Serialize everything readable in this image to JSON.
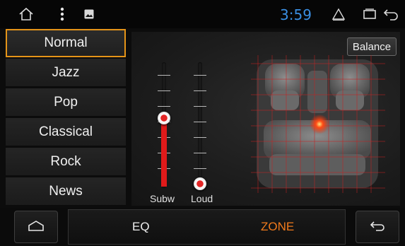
{
  "status_bar": {
    "time": "3:59",
    "icons": [
      "home-outline-icon",
      "more-vert-icon",
      "gallery-icon",
      "alert-triangle-icon",
      "recent-apps-icon",
      "back-arrow-icon"
    ],
    "time_color": "#3a8fe3"
  },
  "presets": [
    {
      "label": "Normal",
      "selected": true
    },
    {
      "label": "Jazz",
      "selected": false
    },
    {
      "label": "Pop",
      "selected": false
    },
    {
      "label": "Classical",
      "selected": false
    },
    {
      "label": "Rock",
      "selected": false
    },
    {
      "label": "News",
      "selected": false
    }
  ],
  "sliders": {
    "subw": {
      "label": "Subw",
      "level": 0.57
    },
    "loud": {
      "label": "Loud",
      "level": 0.0
    }
  },
  "balance": {
    "button_label": "Balance",
    "focus_position": {
      "front_rear": 0.46,
      "left_right": 0.5
    }
  },
  "bottom": {
    "tabs": [
      {
        "label": "EQ",
        "active": false
      },
      {
        "label": "ZONE",
        "active": true
      }
    ]
  },
  "colors": {
    "accent": "#e59418",
    "active_tab": "#f07a1c",
    "slider_fill": "#e01a1a"
  }
}
